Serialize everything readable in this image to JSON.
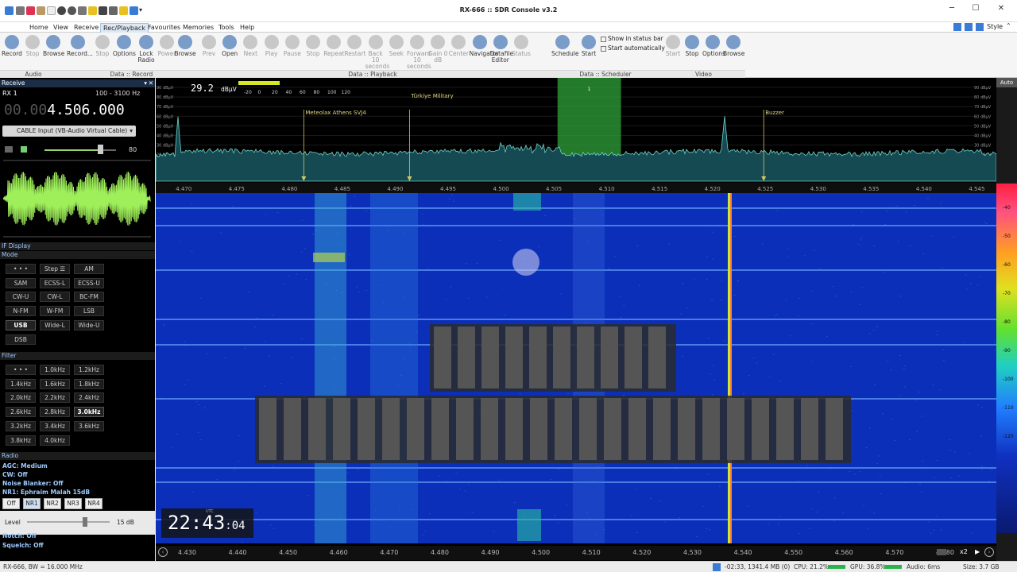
{
  "window": {
    "title": "RX-666 :: SDR Console v3.2"
  },
  "menu": [
    "Home",
    "View",
    "Receive",
    "Rec/Playback",
    "Favourites",
    "Memories",
    "Tools",
    "Help"
  ],
  "menu_active": "Rec/Playback",
  "style_label": "Style",
  "ribbon": {
    "audio": [
      {
        "label": "Record",
        "dim": false
      },
      {
        "label": "Stop",
        "dim": true
      },
      {
        "label": "Browse",
        "dim": false
      }
    ],
    "record": [
      {
        "label": "Record...",
        "dim": false
      },
      {
        "label": "Stop",
        "dim": true
      },
      {
        "label": "Options",
        "dim": false
      },
      {
        "label": "Lock Radio",
        "dim": false
      },
      {
        "label": "Power",
        "dim": true
      },
      {
        "label": "Browse",
        "dim": false
      }
    ],
    "playback": [
      {
        "label": "Prev",
        "dim": true
      },
      {
        "label": "Open",
        "dim": false
      },
      {
        "label": "Next",
        "dim": true
      },
      {
        "label": "Play",
        "dim": true
      },
      {
        "label": "Pause",
        "dim": true
      },
      {
        "label": "Stop",
        "dim": true
      },
      {
        "label": "Repeat",
        "dim": true
      },
      {
        "label": "Restart",
        "dim": true
      },
      {
        "label": "Back 10 seconds",
        "dim": true
      },
      {
        "label": "Seek",
        "dim": true
      },
      {
        "label": "Forward 10 seconds",
        "dim": true
      },
      {
        "label": "Gain 0 dB",
        "dim": true
      },
      {
        "label": "Center",
        "dim": true
      },
      {
        "label": "Navigator",
        "dim": false
      },
      {
        "label": "Datafile Editor",
        "dim": false
      },
      {
        "label": "Status",
        "dim": true
      }
    ],
    "scheduler": [
      {
        "label": "Schedule",
        "dim": false
      },
      {
        "label": "Start",
        "dim": false
      }
    ],
    "scheduler_checks": [
      "Show in status bar",
      "Start automatically"
    ],
    "video": [
      {
        "label": "Start",
        "dim": true
      },
      {
        "label": "Stop",
        "dim": false
      },
      {
        "label": "Options",
        "dim": false
      },
      {
        "label": "Browse",
        "dim": false
      }
    ],
    "groups": [
      "Audio",
      "Data :: Record",
      "Data :: Playback",
      "Data :: Scheduler",
      "Video"
    ]
  },
  "receive": {
    "header": "Receive",
    "rx": "RX 1",
    "bw_range": "100 - 3100 Hz",
    "freq_dim": "00.00",
    "freq_main": "4.506.000",
    "input": "CABLE Input (VB-Audio Virtual Cable)",
    "volume": "80"
  },
  "if_display": "IF Display",
  "mode": {
    "header": "Mode",
    "buttons": [
      "• • •",
      "Step ☰",
      "AM",
      "SAM",
      "ECSS-L",
      "ECSS-U",
      "CW-U",
      "CW-L",
      "BC-FM",
      "N-FM",
      "W-FM",
      "LSB",
      "USB",
      "Wide-L",
      "Wide-U",
      "DSB"
    ],
    "selected": "USB"
  },
  "filter": {
    "header": "Filter",
    "buttons": [
      "• • •",
      "1.0kHz",
      "1.2kHz",
      "1.4kHz",
      "1.6kHz",
      "1.8kHz",
      "2.0kHz",
      "2.2kHz",
      "2.4kHz",
      "2.6kHz",
      "2.8kHz",
      "3.0kHz",
      "3.2kHz",
      "3.4kHz",
      "3.6kHz",
      "3.8kHz",
      "4.0kHz"
    ],
    "selected": "3.0kHz"
  },
  "radio": {
    "header": "Radio",
    "agc": "AGC: Medium",
    "cw": "CW: Off",
    "nb": "Noise Blanker: Off",
    "nr": "NR1: Ephraim Malah 15dB",
    "nr_buttons": [
      "Off",
      "NR1",
      "NR2",
      "NR3",
      "NR4"
    ],
    "nr_selected": "NR1",
    "level_label": "Level",
    "level_value": "15 dB",
    "notch": "Notch: Off",
    "squelch": "Squelch: Off"
  },
  "spectrum": {
    "level": "29.2",
    "level_unit": "dBµV",
    "meter_ticks": [
      "-20",
      "0",
      "20",
      "40",
      "60",
      "80",
      "100",
      "120"
    ],
    "db_labels": [
      "90 dBµV",
      "80 dBµV",
      "70 dBµV",
      "60 dBµV",
      "50 dBµV",
      "40 dBµV",
      "30 dBµV",
      "20 dBµV",
      "10 dBµV",
      "0 dBµV"
    ],
    "markers": [
      {
        "label": "Meteolax Athens SVJ4",
        "freq": 4.4815
      },
      {
        "label": "Türkiye Military",
        "freq": 4.4915
      },
      {
        "label": "Buzzer",
        "freq": 4.525
      }
    ],
    "freq_ticks": [
      "4.470",
      "4.475",
      "4.480",
      "4.485",
      "4.490",
      "4.495",
      "4.500",
      "4.505",
      "4.510",
      "4.515",
      "4.520",
      "4.525",
      "4.530",
      "4.535",
      "4.540",
      "4.545"
    ],
    "filter_label": "1",
    "auto": "Auto"
  },
  "waterfall": {
    "freq_ticks": [
      "4.430",
      "4.440",
      "4.450",
      "4.460",
      "4.470",
      "4.480",
      "4.490",
      "4.500",
      "4.510",
      "4.520",
      "4.530",
      "4.540",
      "4.550",
      "4.560",
      "4.570",
      "4.580"
    ],
    "zoom": "x2",
    "clock_main": "22:43",
    "clock_sec": "04",
    "clock_small": "UTC",
    "scale": [
      "-40",
      "-50",
      "-60",
      "-70",
      "-80",
      "-90",
      "-100",
      "-110",
      "-120"
    ]
  },
  "statusbar": {
    "left": "RX-666, BW = 16.000 MHz",
    "time": "-02:33, 1341.4 MB (0)",
    "cpu": "CPU: 21.2%",
    "gpu": "GPU: 36.8%",
    "audio": "Audio: 6ms",
    "size": "Size: 3.7 GB"
  },
  "colors": {
    "accent": "#9ecbff",
    "waterfall_bg": "#0b2fb8",
    "spectrum_trace": "#6fd3c6",
    "signal": "#c9e63a"
  }
}
